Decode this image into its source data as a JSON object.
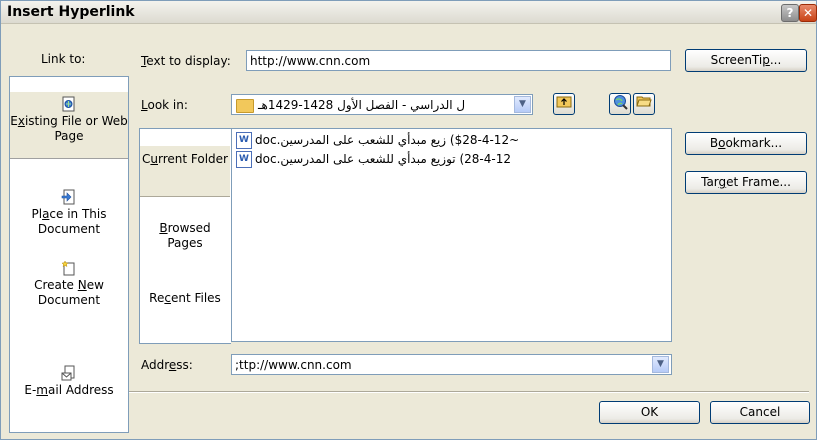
{
  "window": {
    "title": "Insert Hyperlink",
    "help_glyph": "?",
    "close_glyph": "✕"
  },
  "link_to": {
    "label": "Link to:",
    "items": [
      {
        "prefix": "E",
        "key": "x",
        "rest": "isting File or Web Page",
        "icon": "existing-file-icon",
        "selected": true
      },
      {
        "prefix": "Pl",
        "key": "a",
        "rest": "ce in This Document",
        "icon": "place-in-document-icon",
        "selected": false
      },
      {
        "prefix": "Create ",
        "key": "N",
        "rest": "ew Document",
        "icon": "new-document-icon",
        "selected": false
      },
      {
        "prefix": "E-",
        "key": "m",
        "rest": "ail Address",
        "icon": "email-address-icon",
        "selected": false
      }
    ]
  },
  "text_to_display": {
    "key": "T",
    "rest": "ext to display:",
    "value": "http://www.cnn.com"
  },
  "screentip": {
    "prefix": "ScreenTi",
    "key": "p",
    "rest": "..."
  },
  "look_in": {
    "key": "L",
    "rest": "ook in:",
    "value": "ل الدراسي - الفصل الأول 1428-1429هـ"
  },
  "tabs": [
    {
      "prefix": "C",
      "key": "u",
      "rest": "rrent Folder",
      "selected": true
    },
    {
      "prefix": "",
      "key": "B",
      "rest": "rowsed Pages",
      "selected": false
    },
    {
      "prefix": "Re",
      "key": "c",
      "rest": "ent Files",
      "selected": false
    }
  ],
  "files": [
    "~$28-4-12) زيع مبدأي للشعب على المدرسين.doc",
    "28-4-12) توزيع مبدأي للشعب على المدرسين.doc"
  ],
  "right_buttons": {
    "bookmark": {
      "prefix": "B",
      "key": "o",
      "rest": "okmark..."
    },
    "target_frame": {
      "prefix": "Tar",
      "key": "g",
      "rest": "et Frame..."
    }
  },
  "address": {
    "prefix": "Addr",
    "key": "e",
    "rest": "ss:",
    "value": ";ttp://www.cnn.com"
  },
  "ok_label": "OK",
  "cancel_label": "Cancel"
}
